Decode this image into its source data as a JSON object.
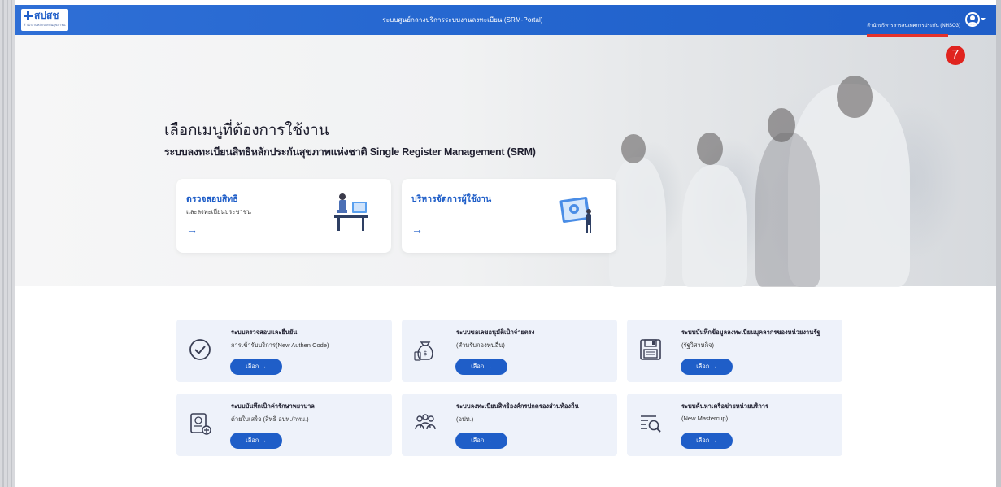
{
  "topbar": {
    "logo_text": "สปสช",
    "logo_subtext": "สำนักงานหลักประกันสุขภาพแห่งชาติ",
    "app_title": "ระบบศูนย์กลางบริการระบบงานลงทะเบียน (SRM-Portal)",
    "org_name": "สำนักบริหารสารสนเทศการประกัน (NHSO3)"
  },
  "step_badge": "7",
  "hero": {
    "heading": "เลือกเมนูที่ต้องการใช้งาน",
    "subheading": "ระบบลงทะเบียนสิทธิหลักประกันสุขภาพแห่งชาติ Single Register Management (SRM)",
    "cards": [
      {
        "title": "ตรวจสอบสิทธิ",
        "subtitle": "และลงทะเบียนประชาชน",
        "arrow": "→"
      },
      {
        "title": "บริหารจัดการผู้ใช้งาน",
        "subtitle": "",
        "arrow": "→"
      }
    ]
  },
  "services": [
    {
      "title": "ระบบตรวจสอบและยืนยัน",
      "subtitle": "การเข้ารับบริการ(New Authen Code)",
      "button": "เลือก →",
      "icon": "check-circle-icon"
    },
    {
      "title": "ระบบขอเลขอนุมัติเบิกจ่ายตรง",
      "subtitle": "(สำหรับกองทุนอื่น)",
      "button": "เลือก →",
      "icon": "money-bag-icon"
    },
    {
      "title": "ระบบบันทึกข้อมูลลงทะเบียนบุคลากรของหน่วยงานรัฐ",
      "subtitle": "(รัฐวิสาหกิจ)",
      "button": "เลือก →",
      "icon": "floppy-disk-icon"
    },
    {
      "title": "ระบบบันทึกเบิกค่ารักษาพยาบาล",
      "subtitle": "ด้วยใบเสร็จ (สิทธิ อปท./กทม.)",
      "button": "เลือก →",
      "icon": "receipt-add-icon"
    },
    {
      "title": "ระบบลงทะเบียนสิทธิองค์กรปกครองส่วนท้องถิ่น",
      "subtitle": "(อปท.)",
      "button": "เลือก →",
      "icon": "people-group-icon"
    },
    {
      "title": "ระบบค้นหาเครือข่ายหน่วยบริการ",
      "subtitle": "(New Mastercup)",
      "button": "เลือก →",
      "icon": "search-list-icon"
    }
  ],
  "colors": {
    "primary": "#1f5ec8",
    "badge": "#e0241f",
    "card_bg": "#eef2fa"
  }
}
